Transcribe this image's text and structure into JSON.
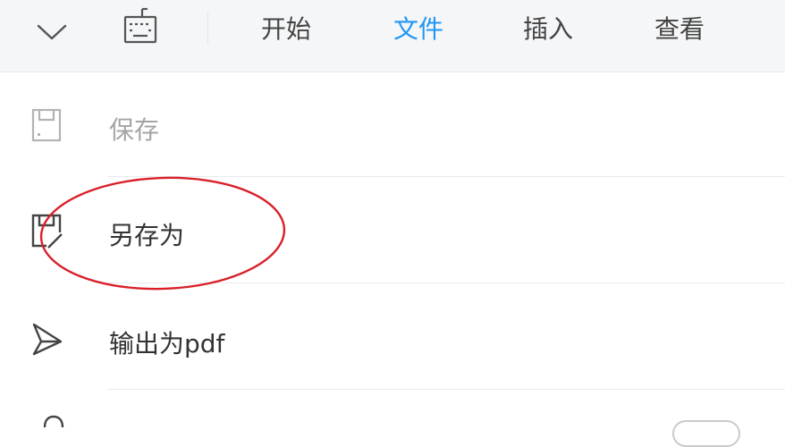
{
  "toolbar": {
    "collapse_icon": "chevron-down-icon",
    "keyboard_icon": "keyboard-icon",
    "tabs": [
      {
        "label": "开始",
        "active": false
      },
      {
        "label": "文件",
        "active": true
      },
      {
        "label": "插入",
        "active": false
      },
      {
        "label": "查看",
        "active": false
      }
    ],
    "active_color": "#2196f3"
  },
  "file_menu": {
    "items": [
      {
        "label": "保存",
        "icon": "save-icon",
        "enabled": false
      },
      {
        "label": "另存为",
        "icon": "save-as-icon",
        "enabled": true,
        "highlighted": true
      },
      {
        "label": "输出为pdf",
        "icon": "send-icon",
        "enabled": true
      }
    ]
  },
  "annotation": {
    "shape": "ellipse",
    "color": "#d9202a",
    "target": "另存为"
  }
}
